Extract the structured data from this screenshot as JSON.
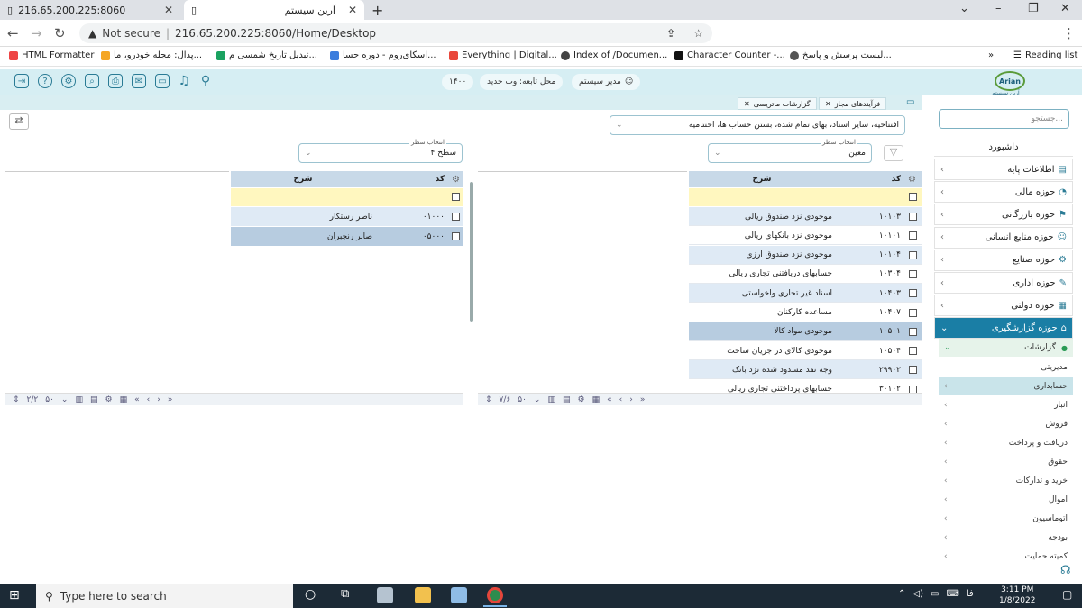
{
  "browser": {
    "tab1_title": "216.65.200.225:8060",
    "tab2_title": "آرین سیستم",
    "omnibox_security": "Not secure",
    "omnibox_url": "216.65.200.225:8060/Home/Desktop",
    "bookmarks": [
      "HTML Formatter",
      "پدال: مجله خودرو، ما...",
      "تبدیل تاریخ شمسی م...",
      "اسکای‌روم - دوره حسا...",
      "Everything | Digital...",
      "Index of /Documen...",
      "Character Counter -...",
      "لیست پرسش و پاسخ..."
    ],
    "reading_list": "Reading list",
    "more": "»"
  },
  "header": {
    "year": "۱۴۰۰",
    "location": "محل تابعه: وب جدید",
    "user": "مدیر سیستم",
    "logo": "Arian",
    "logo_sub": "آرین سیستم"
  },
  "tabs": {
    "matrix": "گزارشات ماتریسی",
    "virtual": "فرآیندهای مجاز"
  },
  "filters": {
    "docs_value": "افتتاحیه، سایر اسناد، بهای تمام شده، بستن حساب ها، اختتامیه",
    "left_label": "انتخاب سطر",
    "left_value": "سطح ۴",
    "right_label": "انتخاب سطر",
    "right_value": "معین"
  },
  "left_grid": {
    "col_code": "کد",
    "col_desc": "شرح",
    "rows": [
      {
        "code": "۰۱۰۰۰",
        "desc": "ناصر رستکار"
      },
      {
        "code": "۰۵۰۰۰",
        "desc": "صابر رنجبران"
      }
    ],
    "count": "۲/۲",
    "pagesize": "۵۰"
  },
  "right_grid": {
    "col_code": "کد",
    "col_desc": "شرح",
    "rows": [
      {
        "code": "۱۰۱۰۳",
        "desc": "موجودی نزد صندوق ریالی"
      },
      {
        "code": "۱۰۱۰۱",
        "desc": "موجودی نزد بانکهای ریالی"
      },
      {
        "code": "۱۰۱۰۴",
        "desc": "موجودی نزد صندوق ارزی"
      },
      {
        "code": "۱۰۳۰۴",
        "desc": "حسابهای دریافتنی تجاری ریالی"
      },
      {
        "code": "۱۰۴۰۳",
        "desc": "اسناد غیر تجاری واخواستی"
      },
      {
        "code": "۱۰۴۰۷",
        "desc": "مساعده کارکنان"
      },
      {
        "code": "۱۰۵۰۱",
        "desc": "موجودی مواد کالا"
      },
      {
        "code": "۱۰۵۰۴",
        "desc": "موجودی کالای در جریان ساخت"
      },
      {
        "code": "۲۹۹۰۲",
        "desc": "وجه نقد مسدود شده نزد بانک"
      },
      {
        "code": "۳۰۱۰۲",
        "desc": "حسابهای پرداختنی تجاری ریالی"
      }
    ],
    "count": "۷/۶",
    "pagesize": "۵۰"
  },
  "sidebar": {
    "search_placeholder": "جستجو...",
    "dashboard": "داشبورد",
    "items": [
      "اطلاعات پایه",
      "حوزه مالی",
      "حوزه بازرگانی",
      "حوزه منابع انسانی",
      "حوزه صنایع",
      "حوزه اداری",
      "حوزه دولتی",
      "حوزه گزارشگیری"
    ],
    "sub_active": "گزارشات",
    "subitems": [
      "مدیریتی",
      "حسابداری",
      "انبار",
      "فروش",
      "دریافت و پرداخت",
      "حقوق",
      "خرید و تدارکات",
      "اموال",
      "اتوماسیون",
      "بودجه",
      "کمیته حمایت"
    ]
  },
  "taskbar": {
    "search": "Type here to search",
    "time": "3:11 PM",
    "date": "1/8/2022",
    "lang": "فا"
  }
}
